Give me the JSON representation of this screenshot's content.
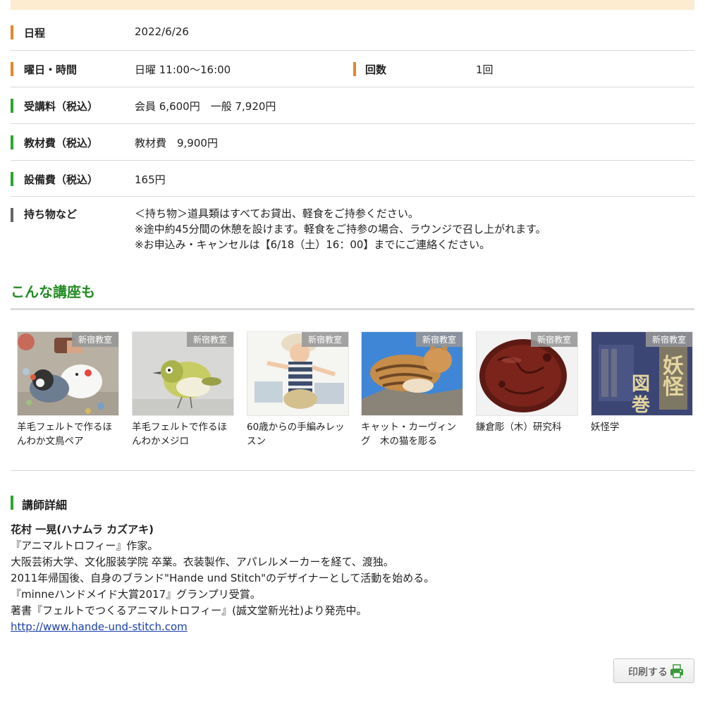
{
  "info": {
    "schedule_label": "日程",
    "schedule_value": "2022/6/26",
    "day_time_label": "曜日・時間",
    "day_time_value": "日曜 11:00〜16:00",
    "count_label": "回数",
    "count_value": "1回",
    "fee_label": "受講料（税込）",
    "fee_value": "会員 6,600円　一般 7,920円",
    "material_label": "教材費（税込）",
    "material_value": "教材費　9,900円",
    "facility_label": "設備費（税込）",
    "facility_value": "165円",
    "items_label": "持ち物など",
    "items_notes": [
      "＜持ち物＞道具類はすべてお貸出、軽食をご持参ください。",
      "※途中約45分間の休憩を設けます。軽食をご持参の場合、ラウンジで召し上がれます。",
      "※お申込み・キャンセルは【6/18（土）16：00】までにご連絡ください。"
    ]
  },
  "related": {
    "title": "こんな講座も",
    "courses": [
      {
        "badge": "新宿教室",
        "title": "羊毛フェルトで作るほんわか文鳥ペア",
        "image": "felt-bird-pair-photo"
      },
      {
        "badge": "新宿教室",
        "title": "羊毛フェルトで作るほんわかメジロ",
        "image": "felt-mejiro-photo"
      },
      {
        "badge": "新宿教室",
        "title": "60歳からの手編みレッスン",
        "image": "knitted-child-photo"
      },
      {
        "badge": "新宿教室",
        "title": "キャット・カーヴィング　木の猫を彫る",
        "image": "cat-carving-photo"
      },
      {
        "badge": "新宿教室",
        "title": "鎌倉彫（木）研究科",
        "image": "kamakura-plate-photo"
      },
      {
        "badge": "新宿教室",
        "title": "妖怪学",
        "image": "yokai-book-cover",
        "cover_text": "妖怪図巻"
      }
    ]
  },
  "instructor": {
    "heading": "講師詳細",
    "name": "花村 一晃(ハナムラ カズアキ)",
    "bio": [
      "『アニマルトロフィー』作家。",
      "大阪芸術大学、文化服装学院 卒業。衣装製作、アパレルメーカーを経て、渡独。",
      "2011年帰国後、自身のブランド\"Hande und Stitch\"のデザイナーとして活動を始める。",
      "『minneハンドメイド大賞2017』グランプリ受賞。",
      "著書『フェルトでつくるアニマルトロフィー』(誠文堂新光社)より発売中。"
    ],
    "link": "http://www.hande-und-stitch.com"
  },
  "actions": {
    "print_label": "印刷する",
    "print_icon": "printer-icon"
  },
  "colors": {
    "orange_bar": "#e8852a",
    "green_bar": "#2fa52f",
    "gray_bar": "#666666",
    "section_green": "#238b23",
    "top_band": "#fdeccf",
    "link_blue": "#1a3fa8"
  }
}
